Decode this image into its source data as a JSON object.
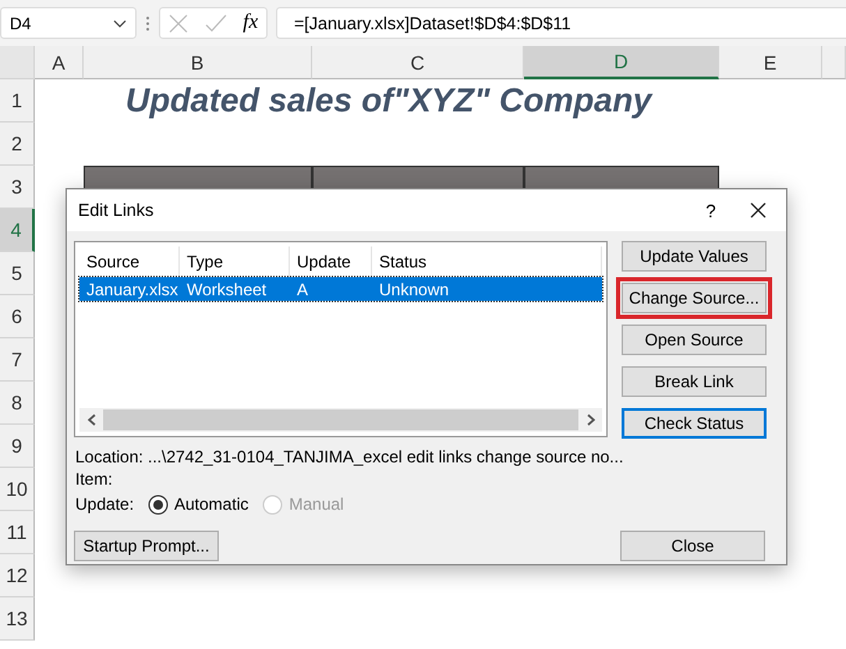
{
  "formula_bar": {
    "name_box": "D4",
    "fx": "fx",
    "formula": "=[January.xlsx]Dataset!$D$4:$D$11"
  },
  "columns": [
    {
      "label": "A",
      "selected": false
    },
    {
      "label": "B",
      "selected": false
    },
    {
      "label": "C",
      "selected": false
    },
    {
      "label": "D",
      "selected": true
    },
    {
      "label": "E",
      "selected": false
    }
  ],
  "rows": [
    {
      "label": "1",
      "selected": false
    },
    {
      "label": "2",
      "selected": false
    },
    {
      "label": "3",
      "selected": false
    },
    {
      "label": "4",
      "selected": true
    },
    {
      "label": "5",
      "selected": false
    },
    {
      "label": "6",
      "selected": false
    },
    {
      "label": "7",
      "selected": false
    },
    {
      "label": "8",
      "selected": false
    },
    {
      "label": "9",
      "selected": false
    },
    {
      "label": "10",
      "selected": false
    },
    {
      "label": "11",
      "selected": false
    },
    {
      "label": "12",
      "selected": false
    },
    {
      "label": "13",
      "selected": false
    }
  ],
  "sheet_title": "Updated sales of\"XYZ\" Company",
  "dialog": {
    "title": "Edit Links",
    "help": "?",
    "list": {
      "columns": [
        "Source",
        "Type",
        "Update",
        "Status"
      ],
      "rows": [
        {
          "cells": [
            "January.xlsx",
            "Worksheet",
            "A",
            "Unknown"
          ],
          "selected": true
        }
      ]
    },
    "buttons": [
      {
        "label": "Update Values",
        "highlighted": false,
        "focused": false
      },
      {
        "label": "Change Source...",
        "highlighted": true,
        "focused": false
      },
      {
        "label": "Open Source",
        "highlighted": false,
        "focused": false
      },
      {
        "label": "Break Link",
        "highlighted": false,
        "focused": false
      },
      {
        "label": "Check Status",
        "highlighted": false,
        "focused": true
      }
    ],
    "location_label": "Location:",
    "location": "...\\2742_31-0104_TANJIMA_excel edit links change source no...",
    "item_label": "Item:",
    "update_label": "Update:",
    "update_options": [
      {
        "label": "Automatic",
        "selected": true,
        "disabled": false
      },
      {
        "label": "Manual",
        "selected": false,
        "disabled": true
      }
    ],
    "startup_button": {
      "label": "Startup Prompt..."
    },
    "close_button": {
      "label": "Close"
    }
  }
}
